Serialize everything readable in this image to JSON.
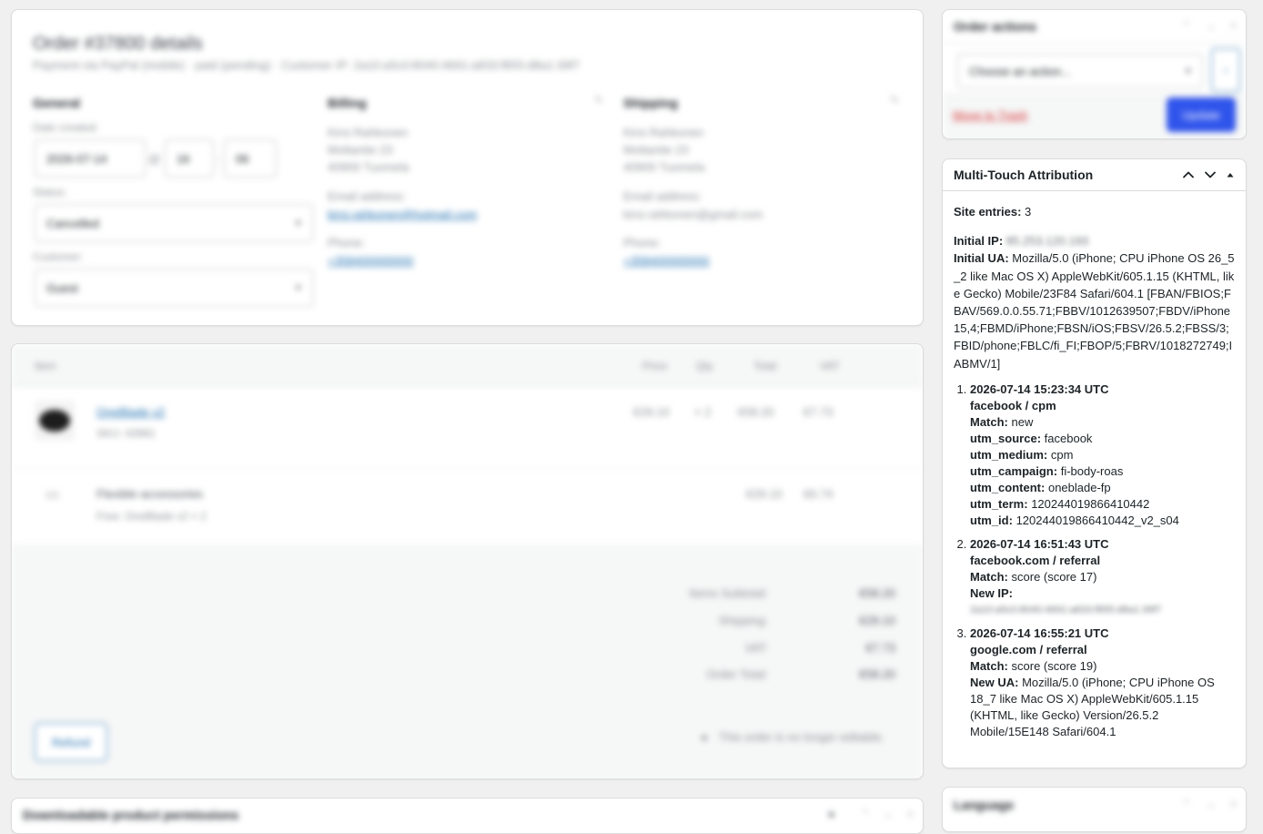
{
  "order_details": {
    "title": "Order #37800 details",
    "subtitle": "Payment via PayPal (mobile) · paid (pending) · Customer IP: 2a10:a5c0:8040:4691:a833:f855:d8a1:39f7",
    "general_label": "General",
    "billing_label": "Billing",
    "shipping_label": "Shipping",
    "date_created_label": "Date created:",
    "date_value": "2026-07-14",
    "hour_value": "16",
    "minute_value": "06",
    "status_label": "Status:",
    "status_value": "Cancelled",
    "customer_label": "Customer:",
    "customer_value": "Guest",
    "billing_lines": [
      "Kirsi Rahkonen",
      "Mottantie 23",
      "40900 Tuomela"
    ],
    "email_label": "Email address:",
    "billing_email": "kirsi.rahkonen@hotmail.com",
    "phone_label": "Phone:",
    "billing_phone": "+358400000000",
    "shipping_lines": [
      "Kirsi Rahkonen",
      "Mottantie 23",
      "40900 Tuomela"
    ],
    "shipping_email": "kirsi.rahkonen@gmail.com",
    "shipping_phone": "+358400000000"
  },
  "items": {
    "col_item": "Item",
    "col_price": "Price",
    "col_qty": "Qty",
    "col_total": "Total",
    "col_vat": "VAT",
    "product_name": "OneBlade v2",
    "product_sku": "SKU: 43991",
    "product_price": "€29.10",
    "product_qty": "× 2",
    "product_total": "€58.20",
    "product_vat": "€7.73",
    "fee_name": "Flexible accessories",
    "fee_meta": "Free: OneBlade v2 × 2",
    "fee_total": "€29.10",
    "fee_vat": "€6.74",
    "summary_items_label": "Items Subtotal:",
    "summary_items_value": "€58.20",
    "summary_shipping_label": "Shipping:",
    "summary_shipping_value": "€29.10",
    "summary_vat_label": "VAT:",
    "summary_vat_value": "€7.73",
    "summary_total_label": "Order Total:",
    "summary_total_value": "€58.20",
    "refund_label": "Refund",
    "refund_note": "This order is no longer editable."
  },
  "downloads": {
    "title": "Downloadable product permissions"
  },
  "order_actions": {
    "title": "Order actions",
    "select_value": "Choose an action...",
    "trash_label": "Move to Trash",
    "update_label": "Update"
  },
  "language": {
    "title": "Language"
  },
  "attribution": {
    "title": "Multi-Touch Attribution",
    "site_entries_label": "Site entries:",
    "site_entries_value": "3",
    "initial_ip_label": "Initial IP:",
    "initial_ip_value": "85.253.120.193",
    "initial_ua_label": "Initial UA:",
    "initial_ua_value": "Mozilla/5.0 (iPhone; CPU iPhone OS 26_5_2 like Mac OS X) AppleWebKit/605.1.15 (KHTML, like Gecko) Mobile/23F84 Safari/604.1 [FBAN/FBIOS;FBAV/569.0.0.55.71;FBBV/1012639507;FBDV/iPhone15,4;FBMD/iPhone;FBSN/iOS;FBSV/26.5.2;FBSS/3;FBID/phone;FBLC/fi_FI;FBOP/5;FBRV/1018272749;IABMV/1]",
    "entries": [
      {
        "time": "2026-07-14 15:23:34 UTC",
        "source": "facebook / cpm",
        "match_label": "Match:",
        "match_value": "new",
        "utm_source_label": "utm_source:",
        "utm_source_value": "facebook",
        "utm_medium_label": "utm_medium:",
        "utm_medium_value": "cpm",
        "utm_campaign_label": "utm_campaign:",
        "utm_campaign_value": "fi-body-roas",
        "utm_content_label": "utm_content:",
        "utm_content_value": "oneblade-fp",
        "utm_term_label": "utm_term:",
        "utm_term_value": "120244019866410442",
        "utm_id_label": "utm_id:",
        "utm_id_value": "120244019866410442_v2_s04"
      },
      {
        "time": "2026-07-14 16:51:43 UTC",
        "source": "facebook.com / referral",
        "match_label": "Match:",
        "match_value": "score (score 17)",
        "new_ip_label": "New IP:",
        "new_ip_value": "2a10:a5c0:8040:4691:a833:f855:d8a1:39f7"
      },
      {
        "time": "2026-07-14 16:55:21 UTC",
        "source": "google.com / referral",
        "match_label": "Match:",
        "match_value": "score (score 19)",
        "new_ua_label": "New UA:",
        "new_ua_value": "Mozilla/5.0 (iPhone; CPU iPhone OS 18_7 like Mac OS X) AppleWebKit/605.1.15 (KHTML, like Gecko) Version/26.5.2 Mobile/15E148 Safari/604.1"
      }
    ]
  }
}
